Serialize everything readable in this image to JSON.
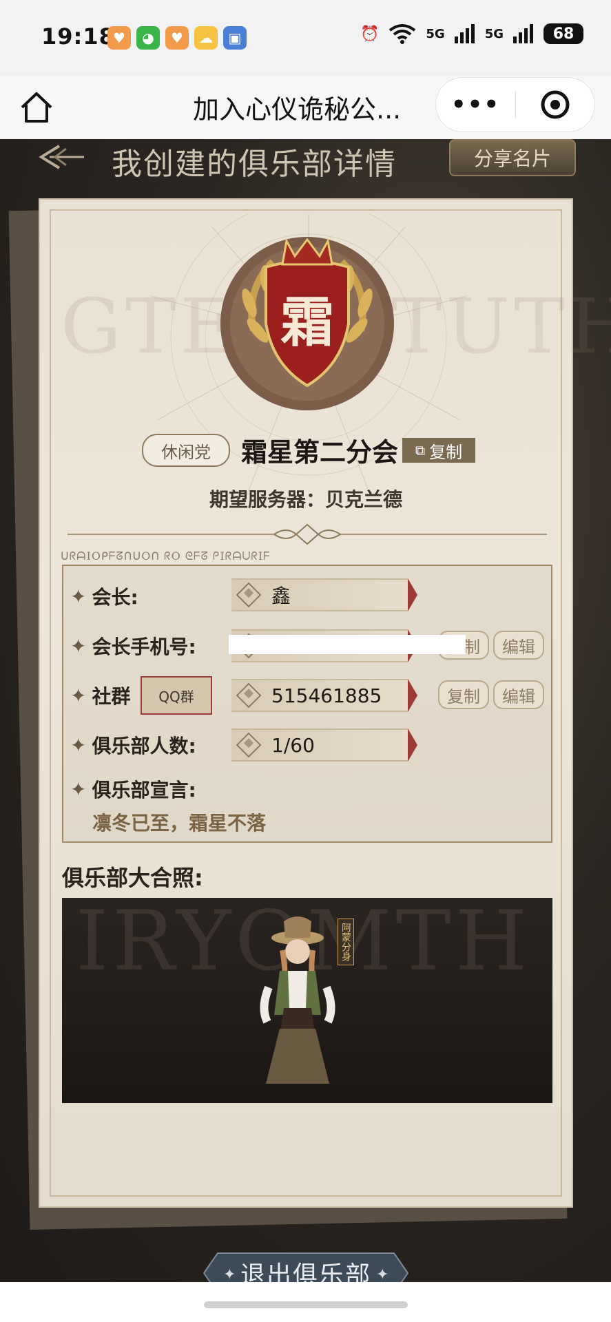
{
  "status_bar": {
    "time": "19:18",
    "network_1": "5G",
    "network_2": "5G",
    "battery": "68"
  },
  "nav": {
    "title": "加入心仪诡秘公...",
    "more_label": "•••"
  },
  "header": {
    "title": "我创建的俱乐部详情",
    "share_label": "分享名片"
  },
  "club": {
    "badge_char": "霜",
    "tag": "休闲党",
    "name": "霜星第二分会",
    "copy_label": "复制",
    "server_label": "期望服务器：贝克兰德",
    "cipher_text": "ᑌᖇᗩIOᑭᖴᘔᑎᑌOᑎ ᖇO ᘓᖴᘔ ᑭIᖇᗩᑌᖇIᖴ",
    "watermark_left": "GTEZ",
    "watermark_right": "TUTH"
  },
  "info": {
    "leader_label": "会长:",
    "leader_value": "鑫",
    "phone_label": "会长手机号:",
    "phone_copy": "复制",
    "phone_edit": "编辑",
    "group_label": "社群",
    "group_type": "QQ群",
    "group_value": "515461885",
    "group_copy": "复制",
    "group_edit": "编辑",
    "members_label": "俱乐部人数:",
    "members_value": "1/60",
    "motto_label": "俱乐部宣言:",
    "motto_value": "凛冬已至，霜星不落"
  },
  "photo": {
    "label": "俱乐部大合照:",
    "tag": "阿蒙分身",
    "watermark": "IRYOMTH"
  },
  "footer": {
    "exit_label": "退出俱乐部"
  }
}
